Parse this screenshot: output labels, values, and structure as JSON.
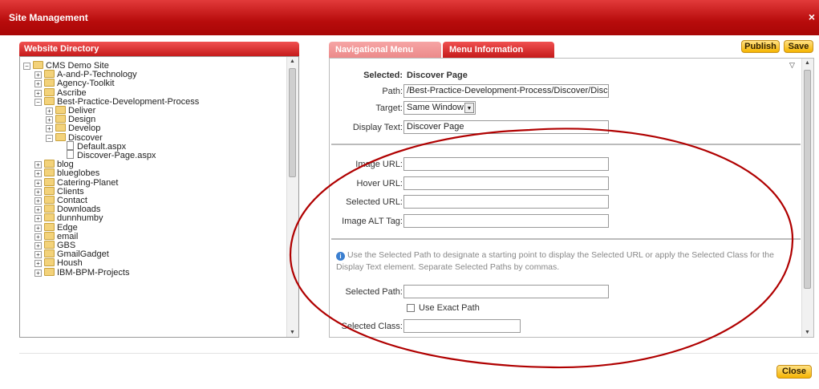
{
  "window": {
    "title": "Site Management",
    "close_glyph": "×"
  },
  "directory": {
    "header": "Website Directory",
    "root": "CMS Demo Site",
    "items_top": [
      "A-and-P-Technology",
      "Agency-Toolkit",
      "Ascribe",
      "Best-Practice-Development-Process"
    ],
    "sub": [
      "Deliver",
      "Design",
      "Develop",
      "Discover"
    ],
    "files": [
      "Default.aspx",
      "Discover-Page.aspx"
    ],
    "items_bottom": [
      "blog",
      "blueglobes",
      "Catering-Planet",
      "Clients",
      "Contact",
      "Downloads",
      "dunnhumby",
      "Edge",
      "email",
      "GBS",
      "GmailGadget",
      "Housh",
      "IBM-BPM-Projects"
    ]
  },
  "tabs": {
    "nav": "Navigational Menu",
    "info": "Menu Information"
  },
  "actions": {
    "publish": "Publish",
    "save": "Save",
    "close": "Close"
  },
  "form": {
    "selected_label": "Selected:",
    "selected_value": "Discover Page",
    "path_label": "Path:",
    "path_value": "/Best-Practice-Development-Process/Discover/Discover",
    "target_label": "Target:",
    "target_value": "Same Window",
    "display_label": "Display Text:",
    "display_value": "Discover Page",
    "image_url_label": "Image URL:",
    "hover_url_label": "Hover URL:",
    "selected_url_label": "Selected URL:",
    "alt_label": "Image ALT Tag:",
    "info_text": "Use the Selected Path to designate a starting point to display the Selected URL or apply the Selected Class for the Display Text element. Separate Selected Paths by commas.",
    "selected_path_label": "Selected Path:",
    "exact_path_label": "Use Exact Path",
    "selected_class_label": "Selected Class:"
  },
  "colors": {
    "header_red": "#c51a1a",
    "accent_yellow": "#f5b400",
    "annotation_red": "#b00000"
  }
}
